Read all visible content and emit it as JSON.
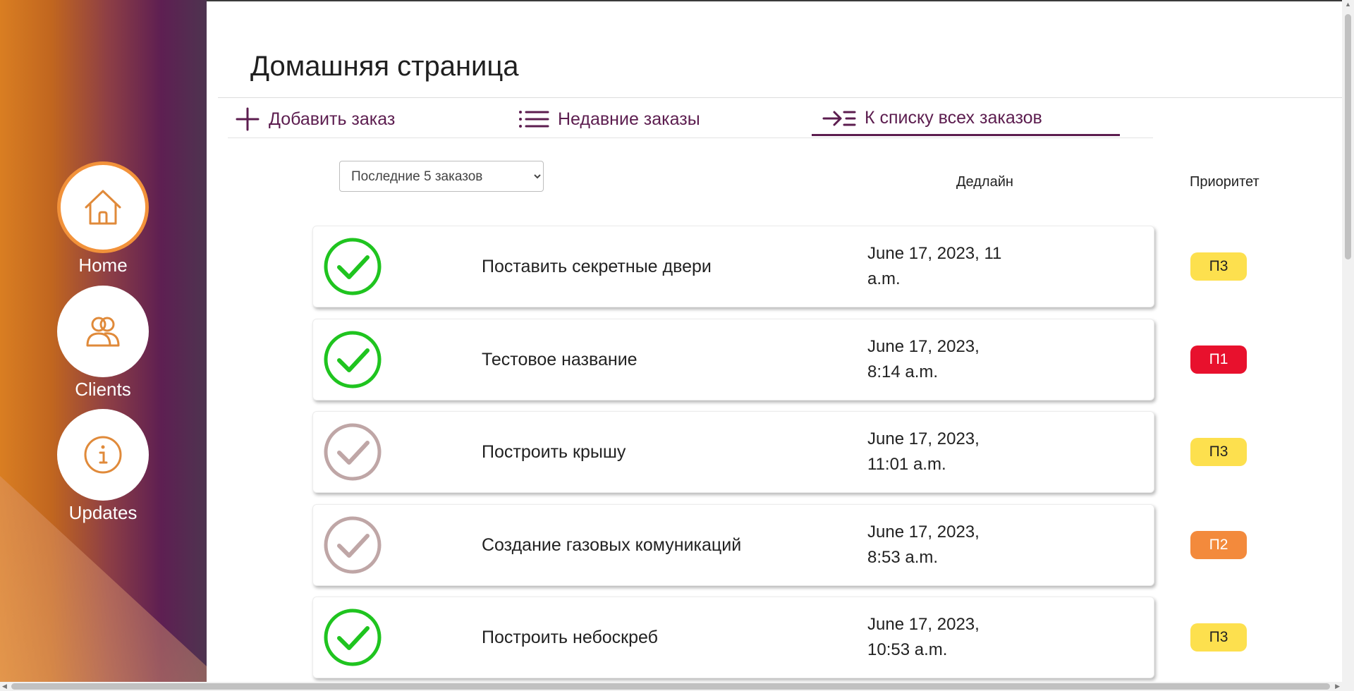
{
  "sidebar": {
    "items": [
      {
        "label": "Home",
        "icon": "home-icon",
        "active": true
      },
      {
        "label": "Clients",
        "icon": "users-icon",
        "active": false
      },
      {
        "label": "Updates",
        "icon": "info-icon",
        "active": false
      }
    ],
    "accent": "#f2923a"
  },
  "header": {
    "title": "Домашняя страница"
  },
  "tabs": [
    {
      "label": "Добавить заказ",
      "icon": "plus-icon",
      "active": false
    },
    {
      "label": "Недавние заказы",
      "icon": "list-icon",
      "active": false
    },
    {
      "label": "К списку всех заказов",
      "icon": "arrow-list-icon",
      "active": true
    }
  ],
  "filter": {
    "selected": "Последние 5 заказов"
  },
  "columns": {
    "deadline": "Дедлайн",
    "priority": "Приоритет"
  },
  "orders": [
    {
      "name": "Поставить секретные двери",
      "deadline": "June 17, 2023, 11 a.m.",
      "priority": "П3",
      "done": true
    },
    {
      "name": "Тестовое название",
      "deadline": "June 17, 2023, 8:14 a.m.",
      "priority": "П1",
      "done": true
    },
    {
      "name": "Построить крышу",
      "deadline": "June 17, 2023, 11:01 a.m.",
      "priority": "П3",
      "done": false
    },
    {
      "name": "Создание газовых комуникаций",
      "deadline": "June 17, 2023, 8:53 a.m.",
      "priority": "П2",
      "done": false
    },
    {
      "name": "Построить небоскреб",
      "deadline": "June 17, 2023, 10:53 a.m.",
      "priority": "П3",
      "done": true
    }
  ],
  "colors": {
    "brand": "#5c1d4f",
    "done": "#1fc41f",
    "pending": "#bfa6a6",
    "p1": "#e8112d",
    "p2": "#f38a3c",
    "p3": "#fde04e"
  }
}
